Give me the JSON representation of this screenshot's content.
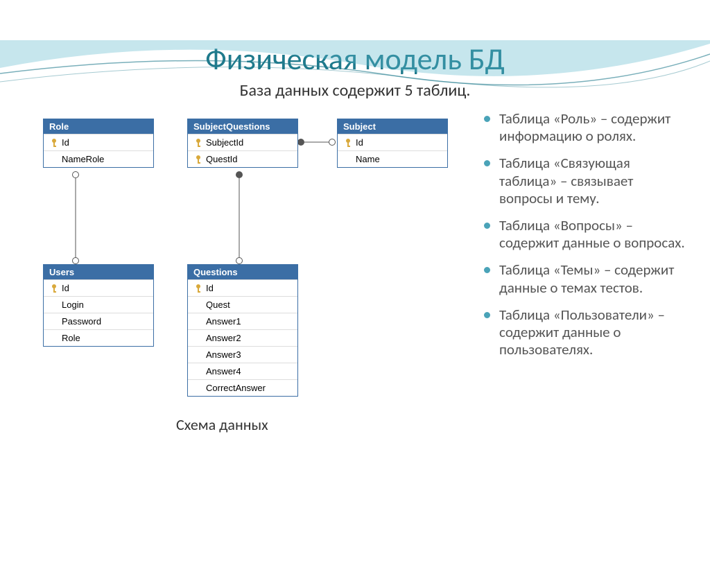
{
  "title": "Физическая модель БД",
  "subtitle": "База данных содержит 5 таблиц.",
  "caption": "Схема данных",
  "tables": {
    "role": {
      "name": "Role",
      "cols": {
        "c0": "Id",
        "c1": "NameRole"
      }
    },
    "subjq": {
      "name": "SubjectQuestions",
      "cols": {
        "c0": "SubjectId",
        "c1": "QuestId"
      }
    },
    "subject": {
      "name": "Subject",
      "cols": {
        "c0": "Id",
        "c1": "Name"
      }
    },
    "users": {
      "name": "Users",
      "cols": {
        "c0": "Id",
        "c1": "Login",
        "c2": "Password",
        "c3": "Role"
      }
    },
    "questions": {
      "name": "Questions",
      "cols": {
        "c0": "Id",
        "c1": "Quest",
        "c2": "Answer1",
        "c3": "Answer2",
        "c4": "Answer3",
        "c5": "Answer4",
        "c6": "CorrectAnswer"
      }
    }
  },
  "bullets": {
    "b0": "Таблица «Роль» – содержит информацию о ролях.",
    "b1": "Таблица «Связующая таблица» – связывает вопросы и тему.",
    "b2": "Таблица «Вопросы» – содержит данные о вопросах.",
    "b3": "Таблица «Темы» – содержит данные о темах тестов.",
    "b4": "Таблица «Пользователи» – содержит данные о пользователях."
  }
}
